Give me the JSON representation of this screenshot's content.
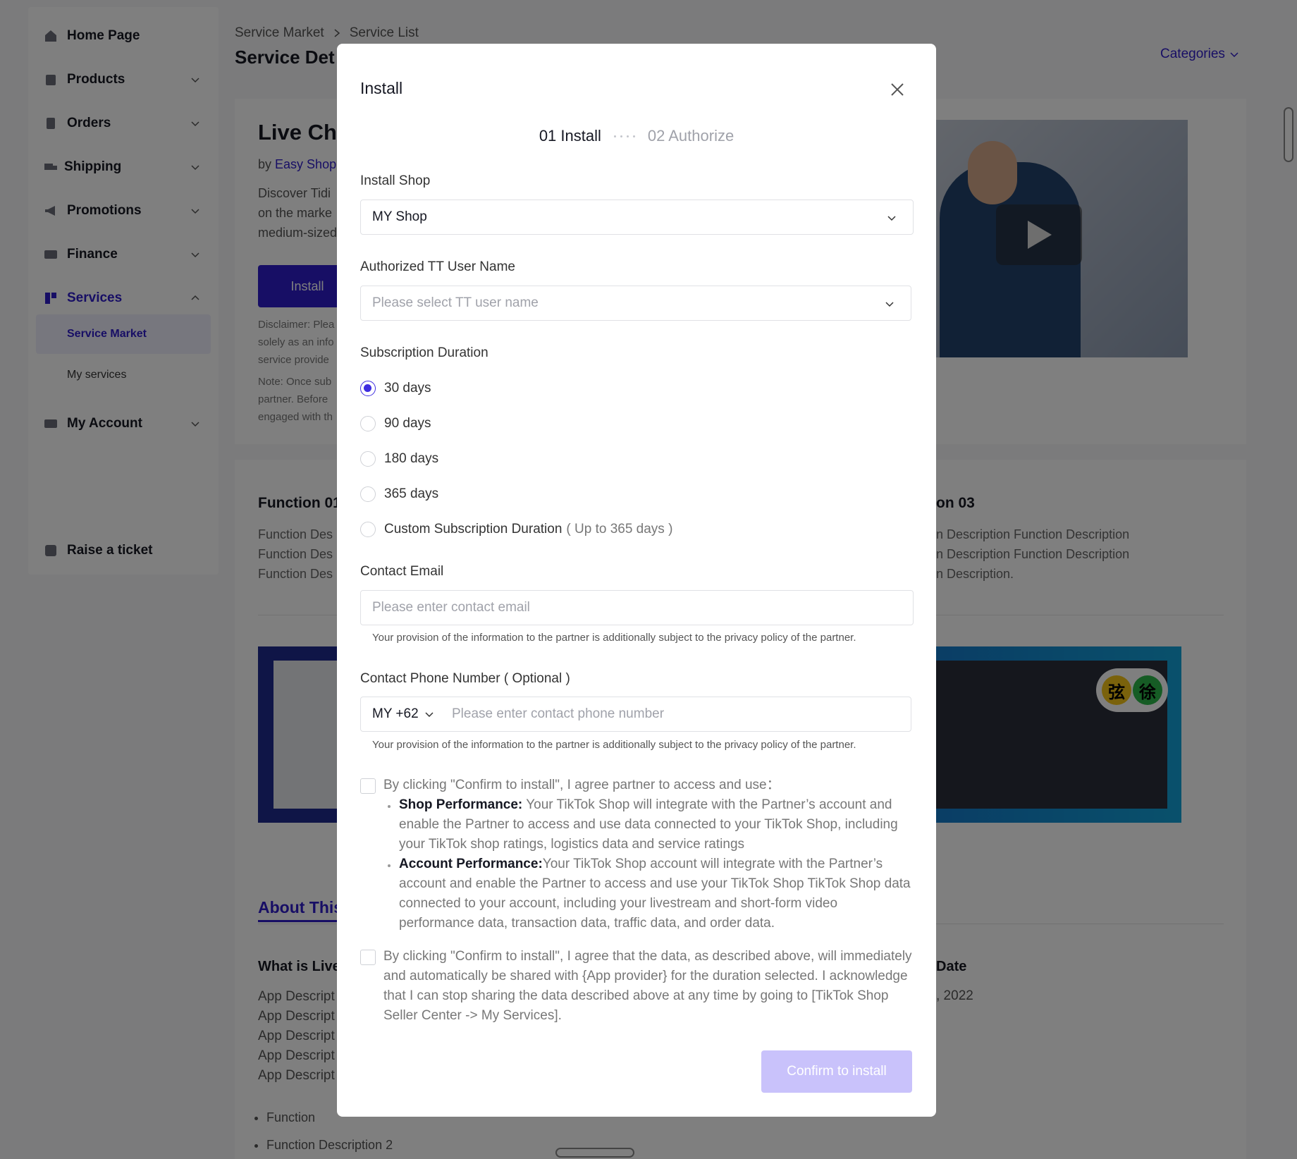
{
  "sidebar": {
    "items": [
      {
        "label": "Home Page"
      },
      {
        "label": "Products"
      },
      {
        "label": "Orders"
      },
      {
        "label": "Shipping"
      },
      {
        "label": "Promotions"
      },
      {
        "label": "Finance"
      },
      {
        "label": "Services"
      },
      {
        "label": "My Account"
      }
    ],
    "sub_items": [
      {
        "label": "Service Market"
      },
      {
        "label": "My services"
      }
    ],
    "raise_ticket": "Raise a ticket"
  },
  "header": {
    "breadcrumb": [
      "Service Market",
      "Service List"
    ],
    "title": "Service Det",
    "categories": "Categories"
  },
  "hero": {
    "title": "Live Ch",
    "by_prefix": "by",
    "by_name": "Easy Shop",
    "description": [
      "Discover Tidi",
      "on the marke",
      "medium-sized"
    ],
    "install_button": "Install",
    "disclaimer": [
      "Disclaimer: Plea",
      "solely as an info",
      "service provide",
      "Note: Once sub",
      "partner. Before",
      "engaged with th"
    ]
  },
  "functions": {
    "fn1_title": "Function 01",
    "fn1_text": [
      "Function  Des",
      "Function  Des",
      "Function  Des"
    ],
    "fn3_title": "on 03",
    "fn3_text": [
      "n  Description Function  Description",
      "n  Description Function  Description",
      "n  Description."
    ],
    "about_tab": "About This",
    "what_title": "What is Live",
    "app_desc": [
      "App Descript",
      "App Descript",
      "App Descript",
      "App Descript",
      "App Descript"
    ],
    "bullets": [
      "Function",
      "Function  Description 2"
    ],
    "date_title": "Date",
    "date_value": ", 2022",
    "badge": [
      "弦",
      "徐"
    ]
  },
  "modal": {
    "title": "Install",
    "step1": "01  Install",
    "step2": "02  Authorize",
    "install_shop_label": "Install Shop",
    "install_shop_value": "MY Shop",
    "tt_user_label": "Authorized TT User Name",
    "tt_user_placeholder": "Please select TT user name",
    "duration_label": "Subscription Duration",
    "durations": [
      "30 days",
      "90 days",
      "180 days",
      "365 days",
      "Custom Subscription Duration"
    ],
    "custom_hint": "( Up to 365 days )",
    "selected_duration": "30 days",
    "email_label": "Contact Email",
    "email_placeholder": "Please enter contact email",
    "privacy_note": "Your provision of the information to the partner is additionally subject to the privacy policy of the partner.",
    "phone_label": "Contact Phone Number ( Optional )",
    "phone_code": "MY +62",
    "phone_placeholder": "Please enter contact phone number",
    "agree1": "By clicking \"Confirm to install\", I agree partner to access and use：",
    "shop_perf_title": "Shop Performance:",
    "shop_perf_text": " Your TikTok Shop will integrate with the Partner’s account and enable the Partner to access and use data connected to your TikTok Shop, including your TikTok shop ratings, logistics data and service ratings",
    "acct_perf_title": "Account Performance:",
    "acct_perf_text": "Your TikTok Shop account will integrate with the Partner’s account and enable the Partner to access and use your TikTok Shop TikTok Shop data connected to your account, including your livestream and short-form video performance data, transaction data, traffic data, and order data.",
    "agree2": "By clicking \"Confirm to install\", I agree that the data, as described above, will immediately and automatically be shared with {App provider} for the duration selected. I acknowledge that I can stop sharing the data described above at any time by going to [TikTok Shop Seller Center -> My Services].",
    "confirm_button": "Confirm to install"
  },
  "colors": {
    "accent": "#2f1ccb",
    "radio_accent": "#3e2de0",
    "confirm_disabled": "#c9c2fb"
  }
}
